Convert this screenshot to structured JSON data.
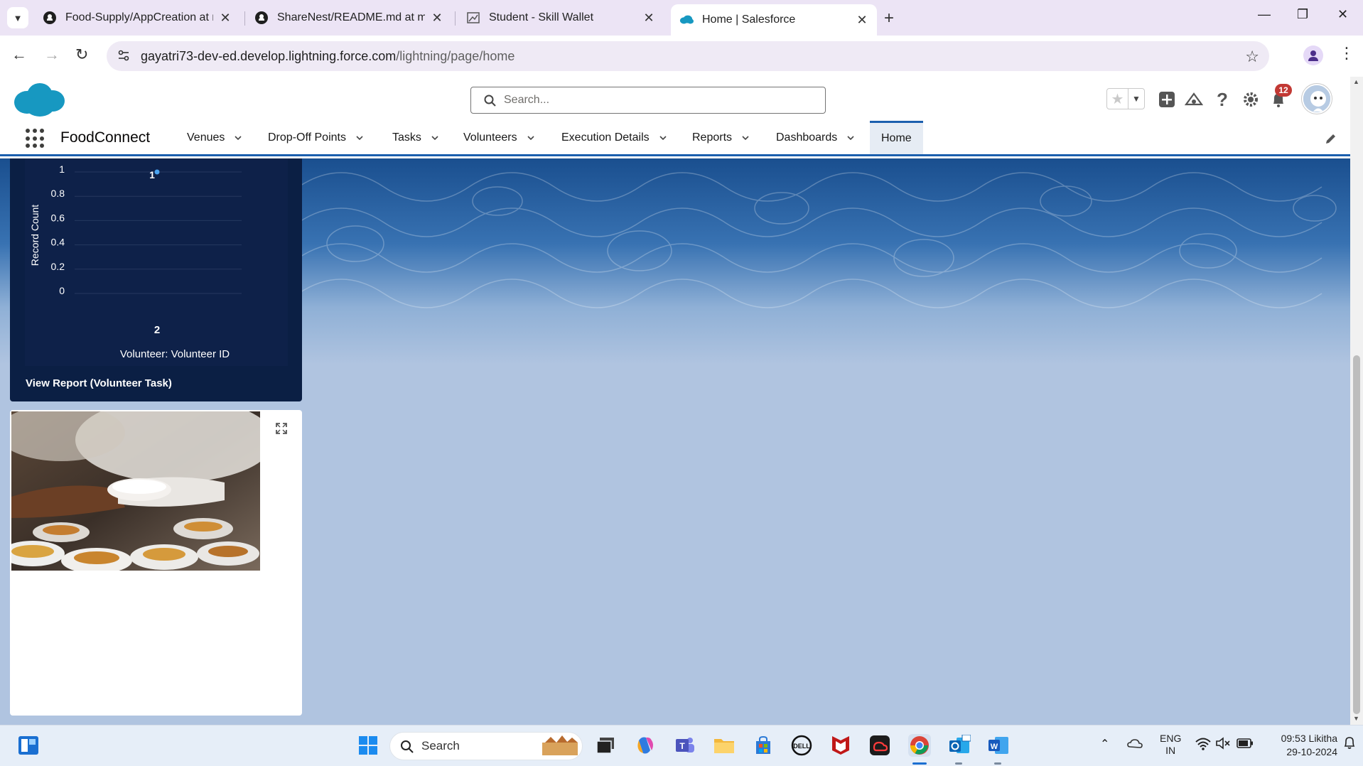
{
  "browser": {
    "tabs": [
      {
        "title": "Food-Supply/AppCreation at m",
        "icon": "github-icon",
        "active": false
      },
      {
        "title": "ShareNest/README.md at main",
        "icon": "github-icon",
        "active": false
      },
      {
        "title": "Student - Skill Wallet",
        "icon": "skill-wallet-icon",
        "active": false
      },
      {
        "title": "Home | Salesforce",
        "icon": "salesforce-cloud-icon",
        "active": true
      }
    ],
    "url_host": "gayatri73-dev-ed.develop.lightning.force.com",
    "url_path": "/lightning/page/home"
  },
  "salesforce": {
    "search_placeholder": "Search...",
    "notification_count": "12",
    "app_name": "FoodConnect",
    "nav_items": [
      {
        "label": "Venues"
      },
      {
        "label": "Drop-Off Points"
      },
      {
        "label": "Tasks"
      },
      {
        "label": "Volunteers"
      },
      {
        "label": "Execution Details"
      },
      {
        "label": "Reports"
      },
      {
        "label": "Dashboards"
      },
      {
        "label": "Home",
        "active": true
      }
    ]
  },
  "chart": {
    "view_report_label": "View Report (Volunteer Task)"
  },
  "chart_data": {
    "type": "scatter",
    "title": "",
    "xlabel": "Volunteer: Volunteer ID",
    "ylabel": "Record Count",
    "y_ticks": [
      "1",
      "0.8",
      "0.6",
      "0.4",
      "0.2",
      "0"
    ],
    "ylim": [
      0,
      1
    ],
    "categories": [
      "2"
    ],
    "values": [
      1
    ],
    "data_labels": [
      "1"
    ],
    "grid": true,
    "colors": {
      "point": "#4aa3f0",
      "background": "#0e2149",
      "text": "#ffffff"
    }
  },
  "taskbar": {
    "search_label": "Search",
    "lang_line1": "ENG",
    "lang_line2": "IN",
    "time": "09:53",
    "user": "Likitha",
    "date": "29-10-2024"
  }
}
